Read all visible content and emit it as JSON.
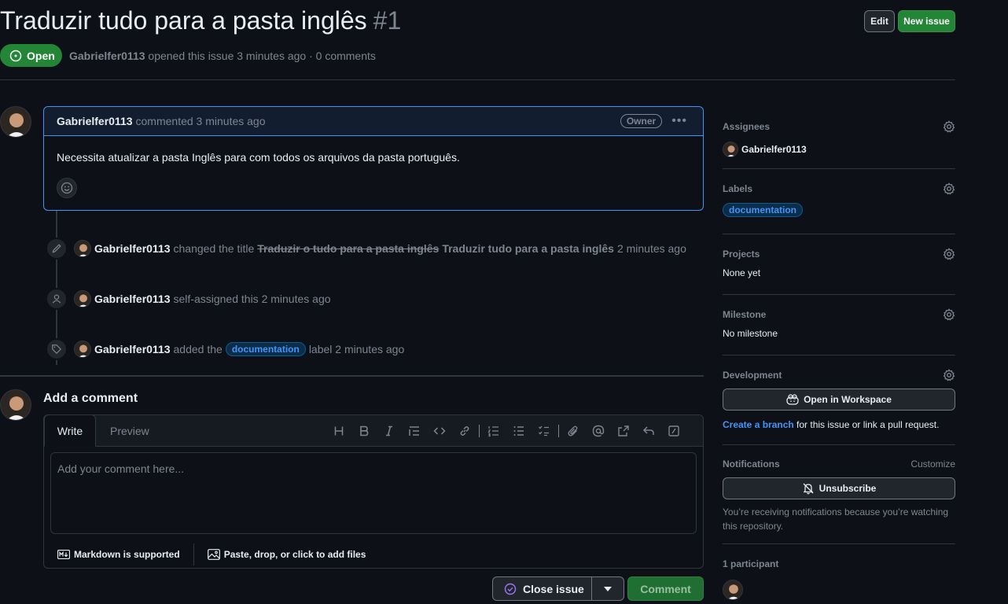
{
  "header": {
    "title": "Traduzir tudo para a pasta inglês",
    "number": "#1",
    "edit_label": "Edit",
    "new_issue_label": "New issue",
    "state": "Open",
    "author": "Gabrielfer0113",
    "meta_text": "opened this issue 3 minutes ago · 0 comments"
  },
  "comment": {
    "author": "Gabrielfer0113",
    "action": "commented 3 minutes ago",
    "badge": "Owner",
    "body": "Necessita atualizar a pasta Inglês para com todos os arquivos da pasta português."
  },
  "timeline": [
    {
      "icon": "pencil-icon",
      "actor": "Gabrielfer0113",
      "verb": "changed the title",
      "old_title": "Traduzir o tudo para a pasta inglês",
      "new_title": "Traduzir tudo para a pasta inglês",
      "time": "2 minutes ago"
    },
    {
      "icon": "person-icon",
      "actor": "Gabrielfer0113",
      "text": "self-assigned this 2 minutes ago"
    },
    {
      "icon": "tag-icon",
      "actor": "Gabrielfer0113",
      "verb": "added the",
      "label": "documentation",
      "suffix": "label 2 minutes ago"
    }
  ],
  "composer": {
    "title": "Add a comment",
    "tab_write": "Write",
    "tab_preview": "Preview",
    "placeholder": "Add your comment here...",
    "markdown_note": "Markdown is supported",
    "attach_note": "Paste, drop, or click to add files",
    "close_label": "Close issue",
    "comment_label": "Comment"
  },
  "sidebar": {
    "assignees": {
      "heading": "Assignees",
      "value": "Gabrielfer0113"
    },
    "labels": {
      "heading": "Labels",
      "value": "documentation"
    },
    "projects": {
      "heading": "Projects",
      "value": "None yet"
    },
    "milestone": {
      "heading": "Milestone",
      "value": "No milestone"
    },
    "development": {
      "heading": "Development",
      "button": "Open in Workspace",
      "link": "Create a branch",
      "rest": "for this issue or link a pull request."
    },
    "notifications": {
      "heading": "Notifications",
      "customize": "Customize",
      "button": "Unsubscribe",
      "note": "You’re receiving notifications because you’re watching this repository."
    },
    "participants": {
      "heading": "1 participant"
    }
  },
  "colors": {
    "background": "#0d1117",
    "accent_blue": "#4493f8",
    "open_green": "#238636",
    "muted": "#7d8590"
  }
}
